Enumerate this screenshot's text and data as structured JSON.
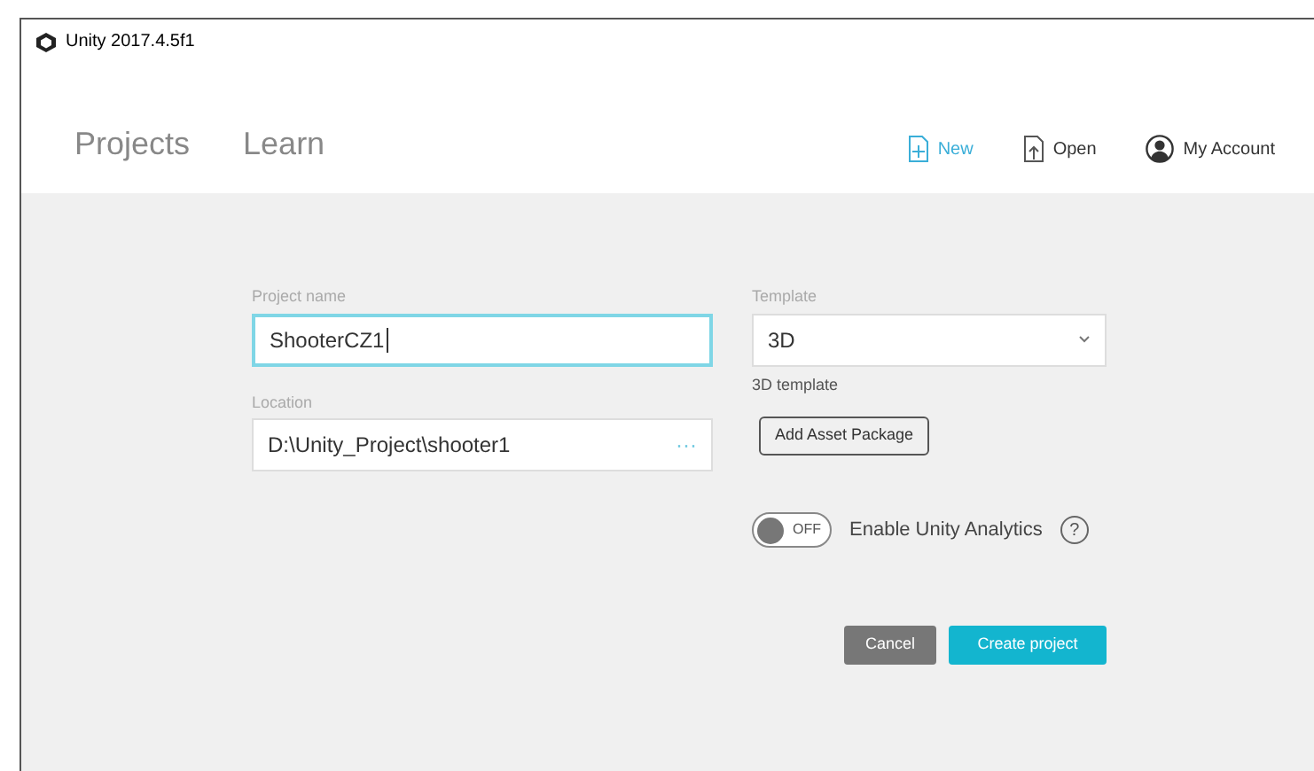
{
  "window": {
    "title": "Unity 2017.4.5f1"
  },
  "nav_tabs": [
    {
      "label": "Projects"
    },
    {
      "label": "Learn"
    }
  ],
  "header_actions": [
    {
      "kind": "new",
      "label": "New",
      "highlighted": true
    },
    {
      "kind": "open",
      "label": "Open",
      "highlighted": false
    },
    {
      "kind": "account",
      "label": "My Account",
      "highlighted": false
    }
  ],
  "form": {
    "project_name": {
      "label": "Project name",
      "value": "ShooterCZ1",
      "focused": true
    },
    "location": {
      "label": "Location",
      "value": "D:\\Unity_Project\\shooter1",
      "browse": "···"
    },
    "template": {
      "label": "Template",
      "value": "3D",
      "description": "3D template"
    },
    "add_asset_button": "Add Asset Package",
    "analytics": {
      "toggle_label": "OFF",
      "on": false,
      "label": "Enable Unity Analytics",
      "help": "?"
    }
  },
  "buttons": [
    {
      "kind": "cancel",
      "label": "Cancel"
    },
    {
      "kind": "primary",
      "label": "Create project"
    }
  ]
}
